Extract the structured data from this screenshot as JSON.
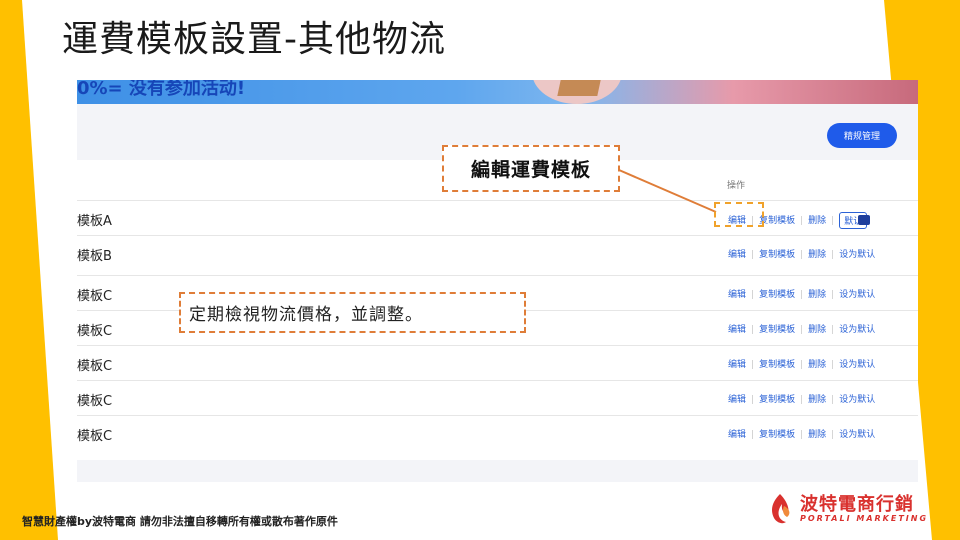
{
  "slide": {
    "title": "運費模板設置-其他物流",
    "footer_copyright": "智慧財產權by波特電商 請勿非法擅自移轉所有權或散布著作原件",
    "logo_main": "波特電商行銷",
    "logo_sub": "PORTALI MARKETING"
  },
  "screenshot": {
    "banner_text": "0%= 没有参加活动!",
    "manage_button": "精规管理",
    "ops_header": "操作",
    "rows": [
      {
        "name": "模板A",
        "edit": "编辑",
        "copy": "复制模板",
        "delete": "删除",
        "default": "默认"
      },
      {
        "name": "模板B",
        "edit": "编辑",
        "copy": "复制模板",
        "delete": "删除",
        "default": "设为默认"
      },
      {
        "name": "模板C",
        "edit": "编辑",
        "copy": "复制模板",
        "delete": "删除",
        "default": "设为默认"
      },
      {
        "name": "模板C",
        "edit": "编辑",
        "copy": "复制模板",
        "delete": "删除",
        "default": "设为默认"
      },
      {
        "name": "模板C",
        "edit": "编辑",
        "copy": "复制模板",
        "delete": "删除",
        "default": "设为默认"
      },
      {
        "name": "模板C",
        "edit": "编辑",
        "copy": "复制模板",
        "delete": "删除",
        "default": "设为默认"
      },
      {
        "name": "模板C",
        "edit": "编辑",
        "copy": "复制模板",
        "delete": "删除",
        "default": "设为默认"
      }
    ]
  },
  "callouts": {
    "edit_template": "編輯運費模板",
    "review_prices": "定期檢視物流價格，並調整。"
  },
  "colors": {
    "accent_yellow": "#ffc000",
    "link_blue": "#2b62d6",
    "button_blue": "#1f5bea",
    "callout_orange": "#df7d38",
    "brand_red": "#d9312e"
  }
}
